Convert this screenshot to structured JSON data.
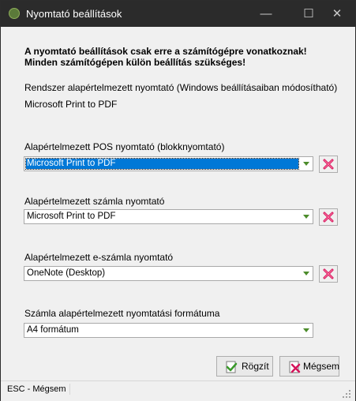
{
  "window": {
    "title": "Nyomtató beállítások",
    "controls": {
      "minimize": "—",
      "maximize": "☐",
      "close": "✕"
    }
  },
  "warning": {
    "line1": "A nyomtató beállítások csak erre a számítógépre vonatkoznak!",
    "line2": "Minden számítógépen külön beállítás szükséges!"
  },
  "system_printer": {
    "label": "Rendszer alapértelmezett nyomtató (Windows beállításaiban módosítható)",
    "value": "Microsoft Print to PDF"
  },
  "pos_printer": {
    "label": "Alapértelmezett POS nyomtató (blokknyomtató)",
    "value": "Microsoft Print to PDF"
  },
  "invoice_printer": {
    "label": "Alapértelmezett számla nyomtató",
    "value": "Microsoft Print to PDF"
  },
  "einvoice_printer": {
    "label": "Alapértelmezett e-számla nyomtató",
    "value": "OneNote (Desktop)"
  },
  "invoice_format": {
    "label": "Számla alapértelmezett nyomtatási formátuma",
    "value": "A4 formátum"
  },
  "buttons": {
    "save": "Rögzít",
    "cancel": "Mégsem"
  },
  "status": {
    "text": "ESC - Mégsem"
  },
  "icons": {
    "app": "app-icon",
    "delete": "red-x-icon",
    "save": "checkmark-document-icon",
    "cancel": "red-x-document-icon",
    "dropdown": "green-arrow-down-icon"
  },
  "colors": {
    "titlebar": "#2b2b2b",
    "selection": "#0078d7",
    "delete_red": "#d4145a",
    "arrow_green": "#4c8c2b"
  }
}
